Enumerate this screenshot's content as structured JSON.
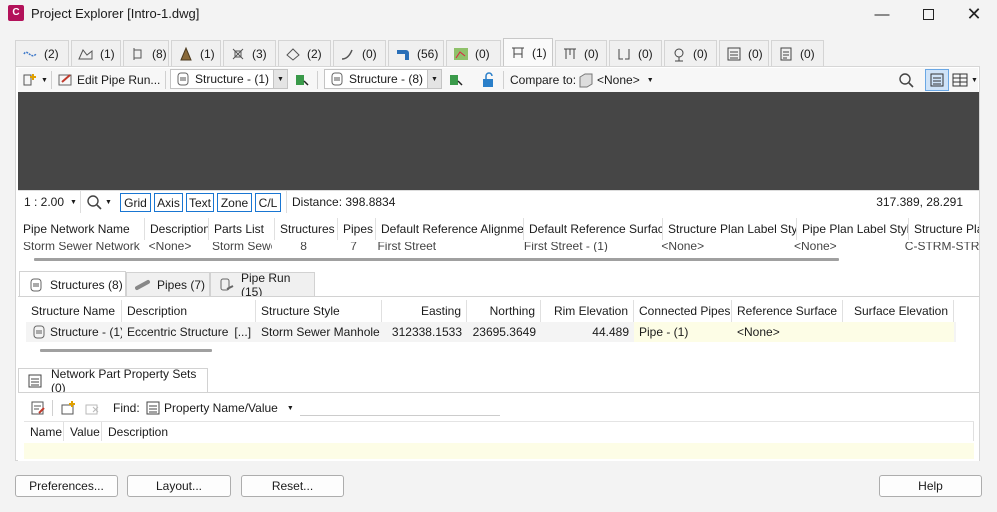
{
  "window": {
    "title": "Project Explorer [Intro-1.dwg]",
    "app_icon_text": "C"
  },
  "top_tabs": [
    {
      "icon": "alignment-icon",
      "count": "(2)"
    },
    {
      "icon": "profile-icon",
      "count": "(1)"
    },
    {
      "icon": "sample-lines-icon",
      "count": "(8)"
    },
    {
      "icon": "corridor-icon",
      "count": "(1)"
    },
    {
      "icon": "feature-lines-icon",
      "count": "(3)"
    },
    {
      "icon": "surface-icon",
      "count": "(2)"
    },
    {
      "icon": "pipe-icon",
      "count": "(0)"
    },
    {
      "icon": "pressure-network-icon",
      "count": "(56)"
    },
    {
      "icon": "catchment-icon",
      "count": "(0)"
    },
    {
      "icon": "pipe-network-icon",
      "count": "(1)"
    },
    {
      "icon": "structure-network-icon",
      "count": "(0)"
    },
    {
      "icon": "pipe-run-icon",
      "count": "(0)"
    },
    {
      "icon": "survey-icon",
      "count": "(0)"
    },
    {
      "icon": "list-icon",
      "count": "(0)"
    },
    {
      "icon": "report-icon",
      "count": "(0)"
    }
  ],
  "toolbar": {
    "edit_pipe_run": "Edit Pipe Run...",
    "structure_a": "Structure - (1)",
    "structure_b": "Structure - (8)",
    "compare_to": "Compare to:",
    "compare_value": "<None>"
  },
  "statusbar": {
    "scale": "1 : 2.00",
    "toggles": [
      "Grid",
      "Axis",
      "Text",
      "Zone",
      "C/L"
    ],
    "distance": "Distance: 398.8834",
    "coords": "317.389, 28.291"
  },
  "network_table": {
    "headers": [
      "Pipe Network Name",
      "Description",
      "Parts List",
      "Structures",
      "Pipes",
      "Default Reference Alignment",
      "Default Reference Surface",
      "Structure Plan Label Style",
      "Pipe Plan Label Style",
      "Structure Pla"
    ],
    "row": [
      "Storm Sewer Network",
      "<None>",
      "Storm Sewer",
      "8",
      "7",
      "First Street",
      "First Street - (1)",
      "<None>",
      "<None>",
      "C-STRM-STR"
    ]
  },
  "sub_tabs": [
    {
      "label": "Structures (8)",
      "icon": "structure-icon"
    },
    {
      "label": "Pipes (7)",
      "icon": "pipe-icon"
    },
    {
      "label": "Pipe Run (15)",
      "icon": "pipe-run-icon"
    }
  ],
  "structure_table": {
    "headers": [
      "Structure Name",
      "Description",
      "Structure Style",
      "Easting",
      "Northing",
      "Rim Elevation",
      "Connected Pipes",
      "Reference Surface",
      "Surface Elevation"
    ],
    "row": [
      "Structure - (1)",
      "Eccentric Structure",
      "[...]",
      "Storm Sewer Manhole",
      "312338.1533",
      "23695.3649",
      "44.489",
      "Pipe - (1)",
      "<None>",
      ""
    ]
  },
  "property_sets": {
    "title": "Network Part Property Sets (0)",
    "find_label": "Find:",
    "find_value": "Property Name/Value",
    "headers": [
      "Name",
      "Value",
      "Description"
    ]
  },
  "buttons": {
    "preferences": "Preferences...",
    "layout": "Layout...",
    "reset": "Reset...",
    "help": "Help"
  },
  "colors": {
    "accent": "#1976d2",
    "viewer": "#464646",
    "highlight": "#fdfde6"
  }
}
